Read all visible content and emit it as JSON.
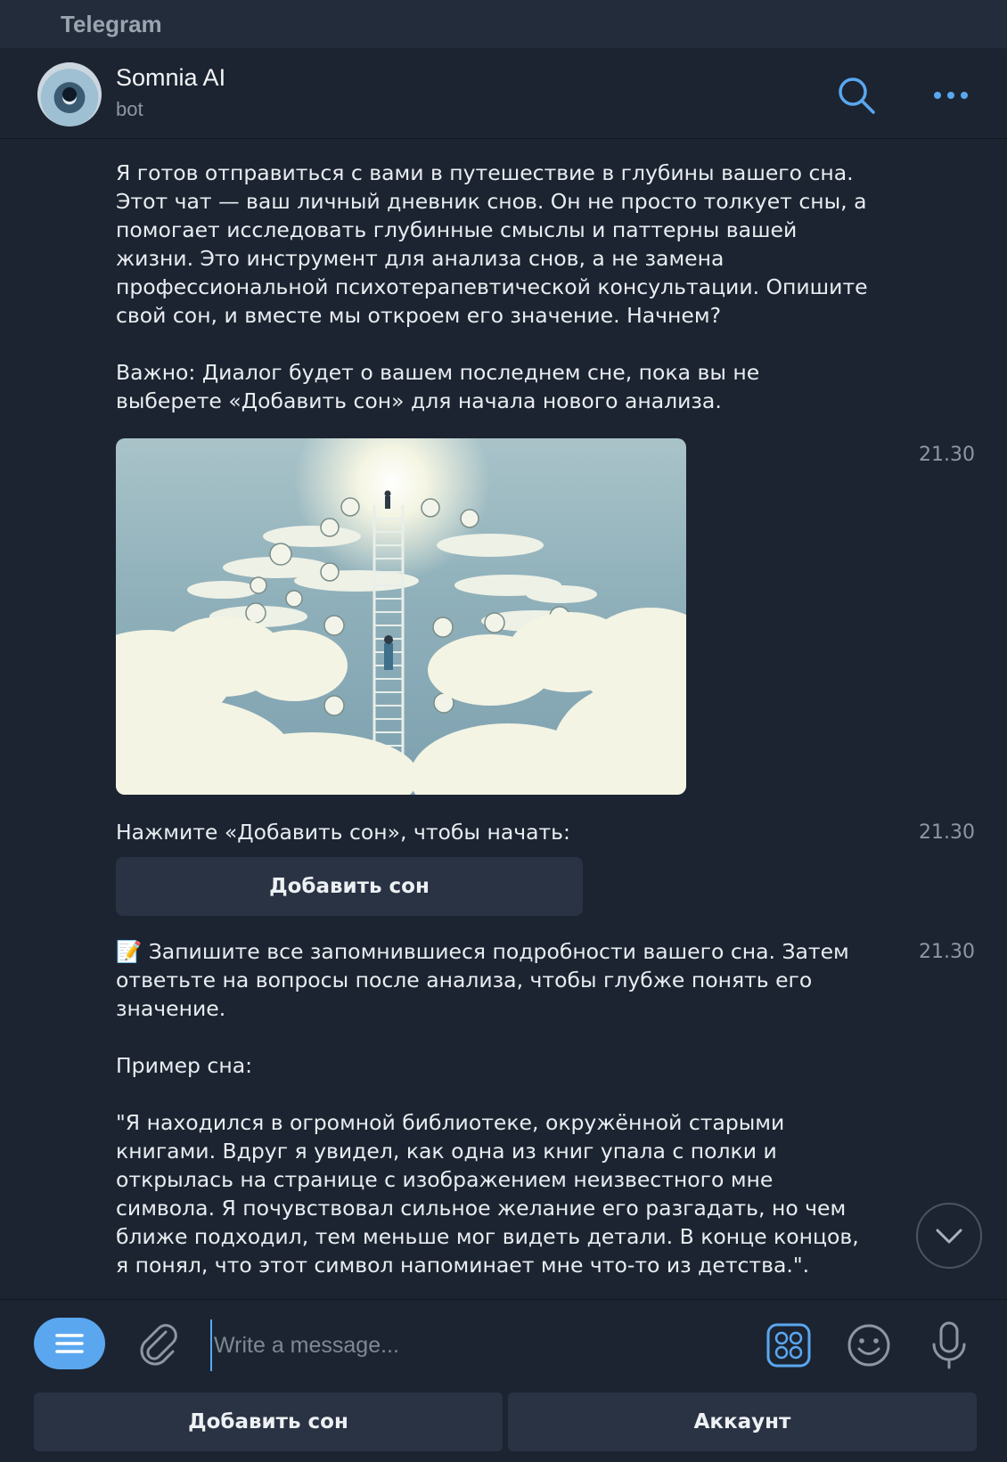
{
  "window": {
    "app_title": "Telegram"
  },
  "header": {
    "name": "Somnia AI",
    "status": "bot"
  },
  "messages": {
    "intro": "Я готов отправиться с вами в путешествие в глубины вашего сна.\nЭтот чат — ваш личный дневник снов. Он не просто толкует сны, а\nпомогает исследовать глубинные смыслы и паттерны вашей\nжизни. Это инструмент для анализа снов, а не замена\nпрофессиональной психотерапевтической консультации. Опишите\nсвой сон, и вместе мы откроем его значение. Начнем?\n\nВажно: Диалог будет о вашем последнем сне, пока вы не\nвыберете «Добавить сон» для начала нового анализа.",
    "photo_time": "21.30",
    "prompt": "Нажмите «Добавить сон», чтобы начать:",
    "prompt_time": "21.30",
    "inline_button": "Добавить сон",
    "instructions": "📝 Запишите все запомнившиеся подробности вашего сна. Затем\nответьте на вопросы после анализа, чтобы глубже понять его\nзначение.\n\nПример сна:\n\n\"Я находился в огромной библиотеке, окружённой старыми\nкнигами. Вдруг я увидел, как одна из книг упала с полки и\nоткрылась на странице с изображением неизвестного мне\nсимвола. Я почувствовал сильное желание его разгадать, но чем\nближе подходил, тем меньше мог видеть детали. В конце концов,\nя понял, что этот символ напоминает мне что-то из детства.\".",
    "instructions_time": "21.30"
  },
  "composer": {
    "placeholder": "Write a message..."
  },
  "keyboard": {
    "left_label": "Добавить сон",
    "right_label": "Аккаунт"
  },
  "colors": {
    "accent": "#5aa7f0",
    "background": "#1c2431",
    "button_bg": "#2a3344"
  },
  "icons": [
    "search-icon",
    "more-icon",
    "chevron-down-icon",
    "menu-icon",
    "attach-icon",
    "commands-icon",
    "emoji-icon",
    "mic-icon"
  ]
}
